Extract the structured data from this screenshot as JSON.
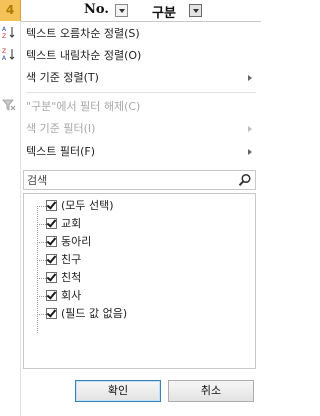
{
  "sheet": {
    "row_number": "4",
    "col_no_label": "No.",
    "col_category_label": "구분"
  },
  "menu": {
    "items": [
      {
        "label": "텍스트 오름차순 정렬(S)",
        "enabled": true,
        "submenu": false
      },
      {
        "label": "텍스트 내림차순 정렬(O)",
        "enabled": true,
        "submenu": false
      },
      {
        "label": "색 기준 정렬(T)",
        "enabled": true,
        "submenu": true
      },
      {
        "label": "\"구분\"에서 필터 해제(C)",
        "enabled": false,
        "submenu": false
      },
      {
        "label": "색 기준 필터(I)",
        "enabled": false,
        "submenu": true
      },
      {
        "label": "텍스트 필터(F)",
        "enabled": true,
        "submenu": true
      }
    ]
  },
  "search": {
    "placeholder": "검색"
  },
  "filter_list": [
    {
      "label": "(모두 선택)",
      "checked": true
    },
    {
      "label": "교회",
      "checked": true
    },
    {
      "label": "동아리",
      "checked": true
    },
    {
      "label": "친구",
      "checked": true
    },
    {
      "label": "친척",
      "checked": true
    },
    {
      "label": "회사",
      "checked": true
    },
    {
      "label": "(필드 값 없음)",
      "checked": true
    }
  ],
  "buttons": {
    "ok": "확인",
    "cancel": "취소"
  },
  "icons": {
    "sort_asc": "sort-ascending-icon",
    "sort_desc": "sort-descending-icon",
    "clear_filter": "clear-filter-icon",
    "search": "search-icon"
  }
}
